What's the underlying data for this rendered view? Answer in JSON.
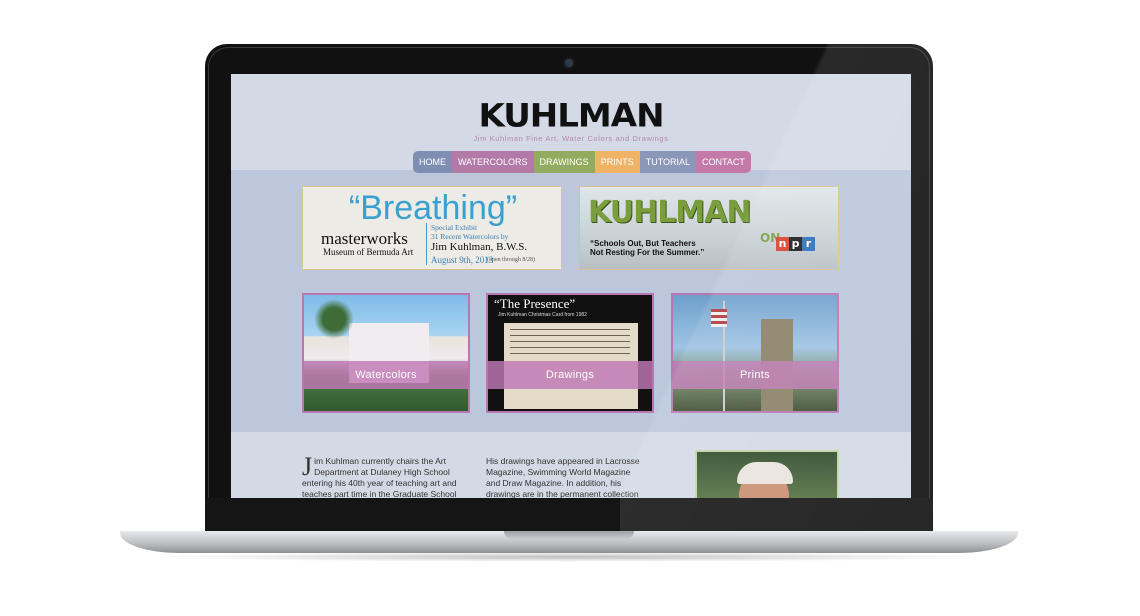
{
  "site": {
    "logo": "KUHLMAN",
    "tagline": "Jim Kuhlman Fine Art, Water Colors and Drawings"
  },
  "nav": [
    {
      "label": "HOME",
      "color": "#7e8fb3"
    },
    {
      "label": "WATERCOLORS",
      "color": "#b27aa7"
    },
    {
      "label": "DRAWINGS",
      "color": "#93ab5e"
    },
    {
      "label": "PRINTS",
      "color": "#f0b264"
    },
    {
      "label": "TUTORIAL",
      "color": "#8b97b8"
    },
    {
      "label": "CONTACT",
      "color": "#c47aa9"
    }
  ],
  "banner_breathing": {
    "title": "“Breathing”",
    "masterworks": "masterworks",
    "museum": "Museum of Bermuda Art",
    "special": "Special Exhibit",
    "recent": "31 Recent Watercolors by",
    "artist": "Jim Kuhlman, B.W.S.",
    "date": "August 9th, 2013",
    "open": "(open through 8/28)"
  },
  "banner_npr": {
    "logo": "KUHLMAN",
    "on": "ON",
    "npr": [
      "n",
      "p",
      "r"
    ],
    "npr_colors": [
      "#d6412c",
      "#1b1b1b",
      "#2a6fb8"
    ],
    "quote_line1": "“Schools Out, But Teachers",
    "quote_line2": "Not Resting For the Summer.”"
  },
  "thumbs": [
    {
      "label": "Watercolors"
    },
    {
      "label": "Drawings",
      "title": "“The Presence”",
      "subtitle": "Jim Kuhlman Christmas Card from 1982"
    },
    {
      "label": "Prints"
    }
  ],
  "bio": {
    "dropcap": "J",
    "col1": "im Kuhlman currently chairs the Art Department at Dulaney High School entering his 40th year of teaching art and teaches part time in the Graduate School of Johns Hopkins University.",
    "col2": "His drawings have appeared in Lacrosse Magazine, Swimming World Magazine and Draw Magazine. In addition, his drawings are in the permanent collection of Mr. and Mrs. Cal Ripken, Jr."
  }
}
